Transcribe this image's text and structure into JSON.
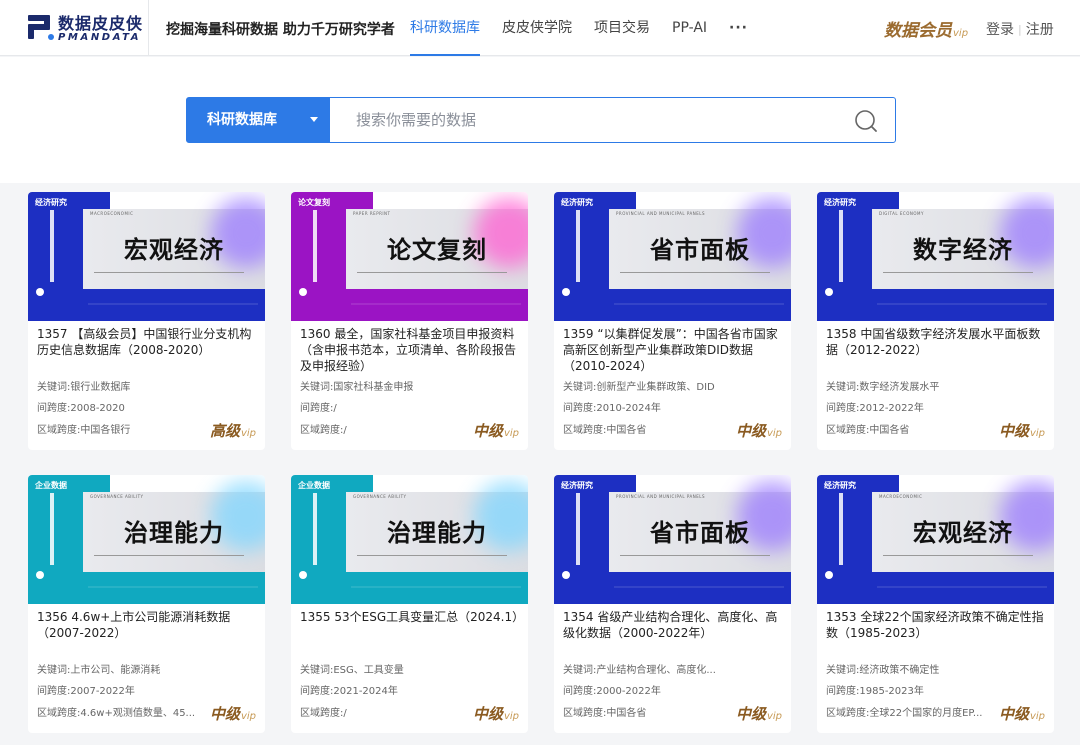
{
  "header": {
    "logo_cn": "数据皮皮侠",
    "logo_en": "PMANDATA",
    "slogan": "挖掘海量科研数据 助力千万研究学者",
    "nav": [
      {
        "label": "科研数据库",
        "active": true
      },
      {
        "label": "皮皮侠学院",
        "active": false
      },
      {
        "label": "项目交易",
        "active": false
      },
      {
        "label": "PP-AI",
        "active": false
      },
      {
        "label": "···",
        "active": false
      }
    ],
    "vip_brand": "数据会员",
    "vip_suffix": "vip",
    "login": "登录",
    "separator": "|",
    "register": "注册"
  },
  "search": {
    "category": "科研数据库",
    "placeholder": "搜索你需要的数据"
  },
  "colors": {
    "primary": "#2d7ae6",
    "gold": "#8a5a20",
    "blue_theme": "#1d2fc2",
    "purple_theme": "#9b14c4",
    "teal_theme": "#10a9c0"
  },
  "cards": [
    {
      "badge": "经济研究",
      "small": "MACROECONOMIC",
      "thumb_title": "宏观经济",
      "theme": "blue",
      "title": "1357 【高级会员】中国银行业分支机构历史信息数据库（2008-2020）",
      "keywords": "关键词:银行业数据库",
      "timespan": "间跨度:2008-2020",
      "region": "区域跨度:中国各银行",
      "level": "高级",
      "level_suffix": "vip"
    },
    {
      "badge": "论文复刻",
      "small": "PAPER REPRINT",
      "thumb_title": "论文复刻",
      "theme": "purple",
      "title": "1360 最全，国家社科基金项目申报资料（含申报书范本，立项清单、各阶段报告及申报经验）",
      "keywords": "关键词:国家社科基金申报",
      "timespan": "间跨度:/",
      "region": "区域跨度:/",
      "level": "中级",
      "level_suffix": "vip"
    },
    {
      "badge": "经济研究",
      "small": "PROVINCIAL AND MUNICIPAL PANELS",
      "thumb_title": "省市面板",
      "theme": "blue",
      "title": "1359 “以集群促发展”：中国各省市国家高新区创新型产业集群政策DID数据（2010-2024）",
      "keywords": "关键词:创新型产业集群政策、DID",
      "timespan": "间跨度:2010-2024年",
      "region": "区域跨度:中国各省",
      "level": "中级",
      "level_suffix": "vip"
    },
    {
      "badge": "经济研究",
      "small": "DIGITAL ECONOMY",
      "thumb_title": "数字经济",
      "theme": "blue",
      "title": "1358 中国省级数字经济发展水平面板数据（2012-2022）",
      "keywords": "关键词:数字经济发展水平",
      "timespan": "间跨度:2012-2022年",
      "region": "区域跨度:中国各省",
      "level": "中级",
      "level_suffix": "vip"
    },
    {
      "badge": "企业数据",
      "small": "GOVERNANCE ABILITY",
      "thumb_title": "治理能力",
      "theme": "teal",
      "title": "1356 4.6w+上市公司能源消耗数据（2007-2022）",
      "keywords": "关键词:上市公司、能源消耗",
      "timespan": "间跨度:2007-2022年",
      "region": "区域跨度:4.6w+观测值数量、45...",
      "level": "中级",
      "level_suffix": "vip"
    },
    {
      "badge": "企业数据",
      "small": "GOVERNANCE ABILITY",
      "thumb_title": "治理能力",
      "theme": "teal",
      "title": "1355 53个ESG工具变量汇总（2024.1）",
      "keywords": "关键词:ESG、工具变量",
      "timespan": "间跨度:2021-2024年",
      "region": "区域跨度:/",
      "level": "中级",
      "level_suffix": "vip"
    },
    {
      "badge": "经济研究",
      "small": "PROVINCIAL AND MUNICIPAL PANELS",
      "thumb_title": "省市面板",
      "theme": "blue",
      "title": "1354 省级产业结构合理化、高度化、高级化数据（2000-2022年）",
      "keywords": "关键词:产业结构合理化、高度化...",
      "timespan": "间跨度:2000-2022年",
      "region": "区域跨度:中国各省",
      "level": "中级",
      "level_suffix": "vip"
    },
    {
      "badge": "经济研究",
      "small": "MACROECONOMIC",
      "thumb_title": "宏观经济",
      "theme": "blue",
      "title": "1353 全球22个国家经济政策不确定性指数（1985-2023）",
      "keywords": "关键词:经济政策不确定性",
      "timespan": "间跨度:1985-2023年",
      "region": "区域跨度:全球22个国家的月度EP...",
      "level": "中级",
      "level_suffix": "vip"
    }
  ]
}
